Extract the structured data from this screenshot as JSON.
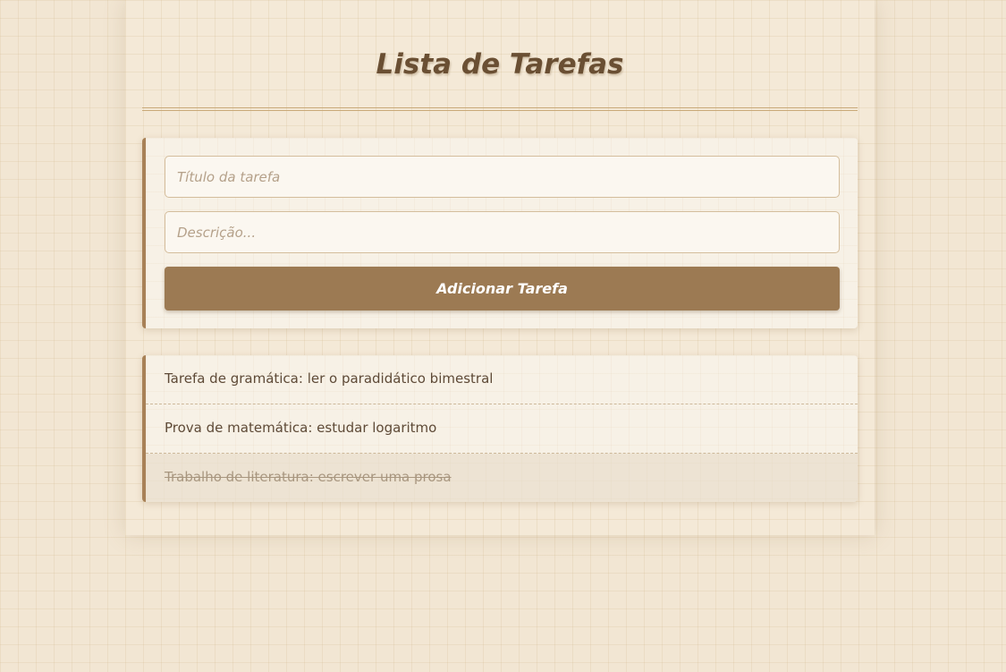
{
  "header": {
    "title": "Lista de Tarefas"
  },
  "form": {
    "title_placeholder": "Título da tarefa",
    "description_placeholder": "Descrição...",
    "add_button_label": "Adicionar Tarefa"
  },
  "tasks": [
    {
      "text": "Tarefa de gramática: ler o paradidático bimestral",
      "done": false
    },
    {
      "text": "Prova de matemática: estudar logaritmo",
      "done": false
    },
    {
      "text": "Trabalho de literatura: escrever uma prosa",
      "done": true
    }
  ],
  "colors": {
    "background": "#f2e6d3",
    "accent": "#9c7a53",
    "title": "#6a4f33",
    "text": "#5e4a37",
    "done_text": "#a8967f"
  }
}
